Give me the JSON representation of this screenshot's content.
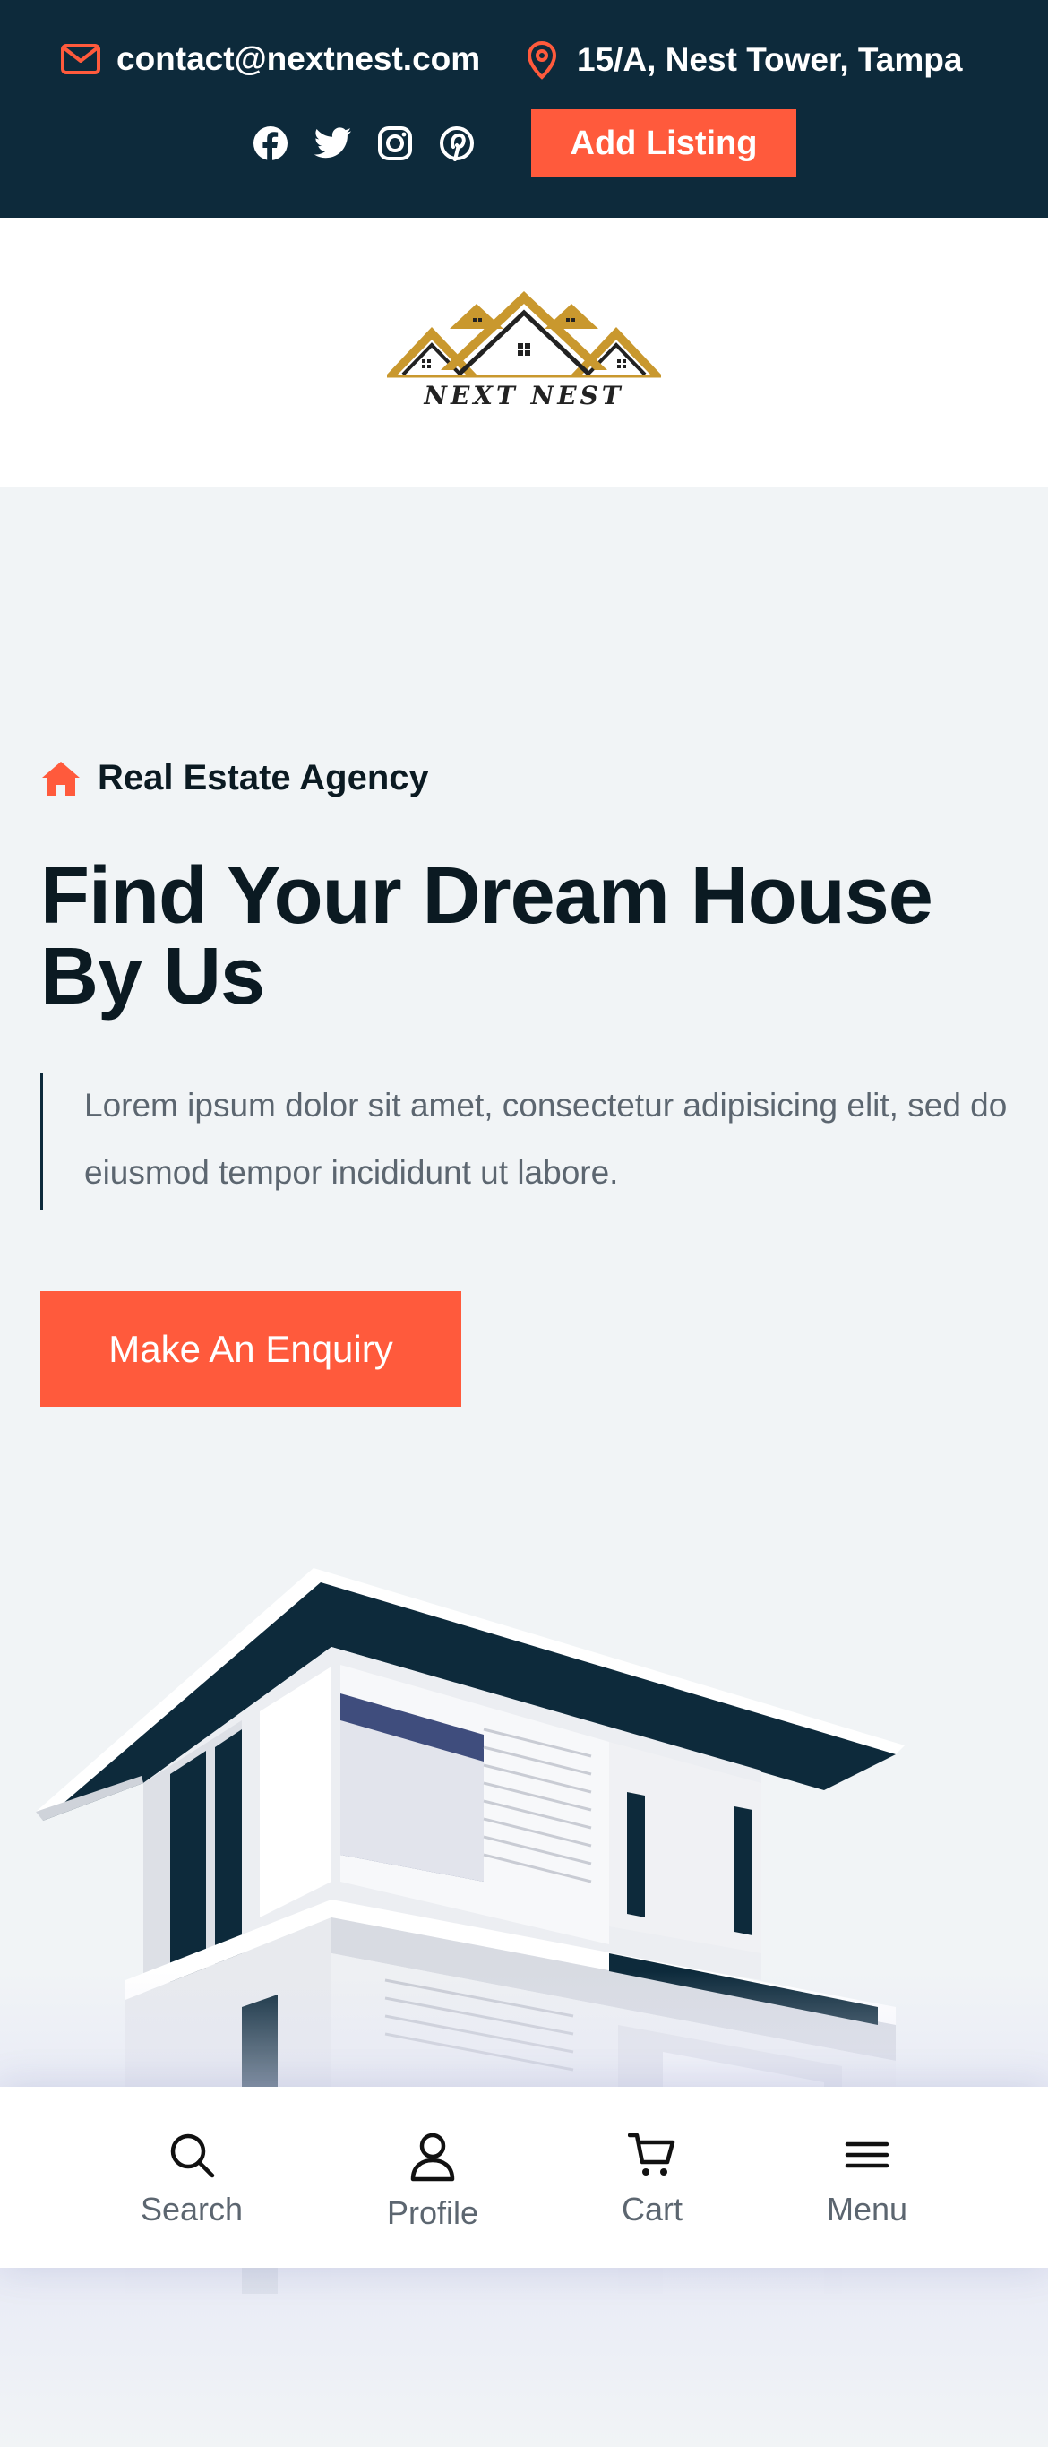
{
  "topbar": {
    "email": "contact@nextnest.com",
    "address": "15/A, Nest Tower, Tampa",
    "social_icons": [
      "facebook-icon",
      "twitter-icon",
      "instagram-icon",
      "pinterest-icon"
    ],
    "add_listing_label": "Add Listing"
  },
  "logo": {
    "text": "NEXT NEST"
  },
  "hero": {
    "tagline": "Real Estate Agency",
    "title": "Find Your Dream House By Us",
    "description": "Lorem ipsum dolor sit amet, consectetur adipisicing elit, sed do eiusmod tempor incididunt ut labore.",
    "cta_label": "Make An Enquiry"
  },
  "bottom_nav": {
    "items": [
      {
        "label": "Search",
        "icon": "search-icon"
      },
      {
        "label": "Profile",
        "icon": "user-icon"
      },
      {
        "label": "Cart",
        "icon": "cart-icon"
      },
      {
        "label": "Menu",
        "icon": "menu-icon"
      }
    ]
  },
  "colors": {
    "topbar_bg": "#0d2a3b",
    "accent": "#ff5a3c",
    "page_bg": "#f1f4f6",
    "logo_gold": "#c9982e",
    "heading": "#0b1a22",
    "muted_text": "#5c6670"
  }
}
